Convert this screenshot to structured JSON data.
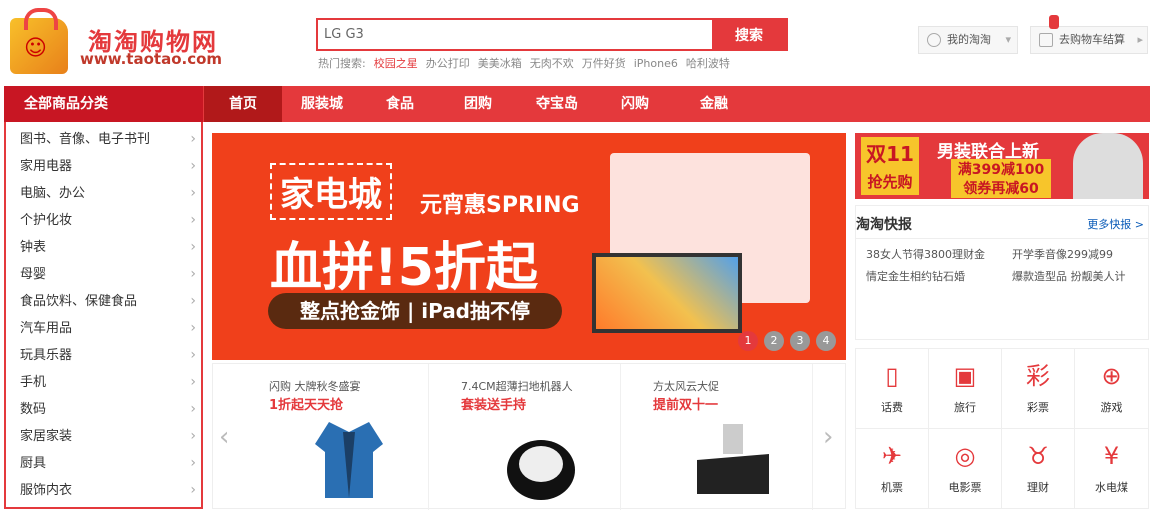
{
  "logo": {
    "cn": "淘淘购物网",
    "url": "www.taotao.com"
  },
  "search": {
    "value": "LG G3",
    "button": "搜索"
  },
  "hot": {
    "label": "热门搜索:",
    "items": [
      "校园之星",
      "办公打印",
      "美美冰箱",
      "无肉不欢",
      "万件好货",
      "iPhone6",
      "哈利波特"
    ]
  },
  "top_right": {
    "my": "我的淘淘",
    "cart": "去购物车结算"
  },
  "nav": {
    "all_categories": "全部商品分类",
    "items": [
      "首页",
      "服装城",
      "食品",
      "团购",
      "夺宝岛",
      "闪购",
      "金融"
    ]
  },
  "categories": [
    "图书、音像、电子书刊",
    "家用电器",
    "电脑、办公",
    "个护化妆",
    "钟表",
    "母婴",
    "食品饮料、保健食品",
    "汽车用品",
    "玩具乐器",
    "手机",
    "数码",
    "家居家装",
    "厨具",
    "服饰内衣"
  ],
  "banner": {
    "title": "家电城",
    "subtitle": "元宵惠SPRING",
    "headline": "血拼!5折起",
    "pill": "整点抢金饰 | iPad抽不停",
    "dots": [
      "1",
      "2",
      "3",
      "4"
    ]
  },
  "promos": [
    {
      "line1": "闪购  大牌秋冬盛宴",
      "line2": "1折起天天抢"
    },
    {
      "line1": "7.4CM超薄扫地机器人",
      "line2": "套装送手持"
    },
    {
      "line1": "方太风云大促",
      "line2": "提前双十一"
    }
  ],
  "ad": {
    "badge_top": "双11",
    "badge_bottom": "抢先购",
    "title": "男装联合上新",
    "line1": "满399减100",
    "line2": "领券再减60"
  },
  "news": {
    "title": "淘淘快报",
    "more": "更多快报 >",
    "items": [
      "38女人节得3800理财金",
      "开学季音像299减99",
      "情定金生相约钻石婚",
      "爆款造型品 扮靓美人计"
    ]
  },
  "services": [
    {
      "label": "话费",
      "icon": "phone-icon",
      "glyph": "▯"
    },
    {
      "label": "旅行",
      "icon": "luggage-icon",
      "glyph": "▣"
    },
    {
      "label": "彩票",
      "icon": "lottery-icon",
      "glyph": "彩"
    },
    {
      "label": "游戏",
      "icon": "gamepad-icon",
      "glyph": "⊕"
    },
    {
      "label": "机票",
      "icon": "airplane-icon",
      "glyph": "✈"
    },
    {
      "label": "电影票",
      "icon": "film-icon",
      "glyph": "◎"
    },
    {
      "label": "理财",
      "icon": "piggybank-icon",
      "glyph": "♉"
    },
    {
      "label": "水电煤",
      "icon": "yuan-icon",
      "glyph": "¥"
    }
  ],
  "colors": {
    "brand_red": "#e4393c",
    "dark_red": "#c81623"
  }
}
